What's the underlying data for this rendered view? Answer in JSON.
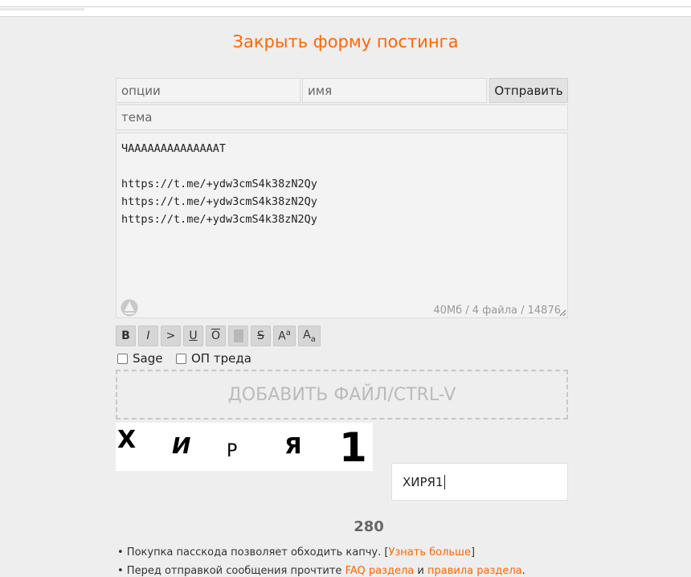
{
  "header": {
    "close_form": "Закрыть форму постинга"
  },
  "form": {
    "options_placeholder": "опции",
    "name_placeholder": "имя",
    "send_label": "Отправить",
    "subject_placeholder": "тема",
    "message_lines": [
      "ЧААААААААААААААТ",
      "",
      "https://t.me/+ydw3cmS4k38zN2Qy",
      "https://t.me/+ydw3cmS4k38zN2Qy",
      "https://t.me/+ydw3cmS4k38zN2Qy"
    ],
    "status": "40Мб / 4 файла / 14876",
    "markup_buttons": [
      "B",
      "I",
      ">",
      "U",
      "O",
      "",
      "S",
      "Aa",
      "Aa"
    ],
    "sage_label": "Sage",
    "op_label": "ОП треда",
    "dropzone_label": "ДОБАВИТЬ ФАЙЛ/CTRL-V",
    "captcha_chars": [
      "Х",
      "И",
      "Р",
      "Я",
      "1"
    ],
    "captcha_value": "ХИРЯ1",
    "counter": "280"
  },
  "notes": {
    "line1_prefix": "• Покупка пасскода позволяет обходить капчу. [",
    "line1_link": "Узнать больше",
    "line1_suffix": "]",
    "line2_prefix": "• Перед отправкой сообщения прочтите ",
    "line2_link1": "FAQ раздела",
    "line2_mid": " и ",
    "line2_link2": "правила раздела",
    "line2_suffix": "."
  },
  "colors": {
    "accent": "#ff6600",
    "background": "#eeeeee",
    "field": "#f3f3f3"
  },
  "icons": [
    "sail-icon",
    "resize-icon"
  ]
}
